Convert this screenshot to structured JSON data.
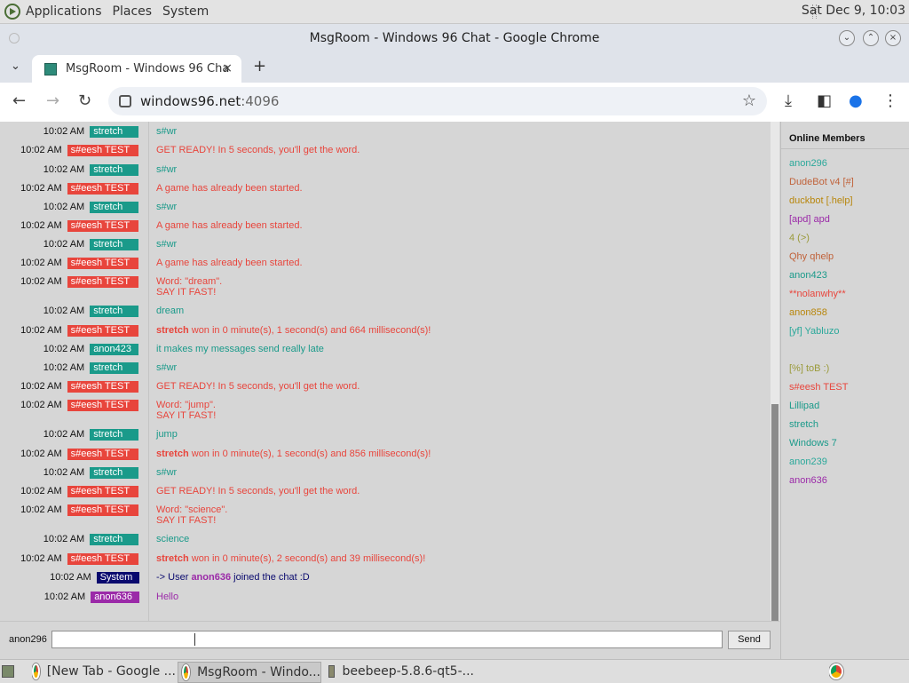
{
  "topbar": {
    "menus": [
      "Applications",
      "Places",
      "System"
    ],
    "clock": "Sat Dec 9, 10:03"
  },
  "window": {
    "title": "MsgRoom - Windows 96 Chat - Google Chrome"
  },
  "tab": {
    "title": "MsgRoom - Windows 96 Cha",
    "close_icon": "×",
    "new_tab_icon": "+"
  },
  "address": {
    "host": "windows96.net",
    "port": ":4096"
  },
  "chat": {
    "messages": [
      {
        "time": "10:02 AM",
        "user": "stretch",
        "badge_color": "#1a9a8a",
        "text": "s#wr",
        "text_color": "#1a9a8a"
      },
      {
        "time": "10:02 AM",
        "user": "s#eesh TEST",
        "badge_color": "#e8453c",
        "text": "GET READY! In 5 seconds, you'll get the word.",
        "text_color": "#e8453c"
      },
      {
        "time": "10:02 AM",
        "user": "stretch",
        "badge_color": "#1a9a8a",
        "text": "s#wr",
        "text_color": "#1a9a8a"
      },
      {
        "time": "10:02 AM",
        "user": "s#eesh TEST",
        "badge_color": "#e8453c",
        "text": "A game has already been started.",
        "text_color": "#e8453c"
      },
      {
        "time": "10:02 AM",
        "user": "stretch",
        "badge_color": "#1a9a8a",
        "text": "s#wr",
        "text_color": "#1a9a8a"
      },
      {
        "time": "10:02 AM",
        "user": "s#eesh TEST",
        "badge_color": "#e8453c",
        "text": "A game has already been started.",
        "text_color": "#e8453c"
      },
      {
        "time": "10:02 AM",
        "user": "stretch",
        "badge_color": "#1a9a8a",
        "text": "s#wr",
        "text_color": "#1a9a8a"
      },
      {
        "time": "10:02 AM",
        "user": "s#eesh TEST",
        "badge_color": "#e8453c",
        "text": "A game has already been started.",
        "text_color": "#e8453c"
      },
      {
        "time": "10:02 AM",
        "user": "s#eesh TEST",
        "badge_color": "#e8453c",
        "text": "Word: \"dream\".",
        "text2": "SAY IT FAST!",
        "text_color": "#e8453c"
      },
      {
        "time": "10:02 AM",
        "user": "stretch",
        "badge_color": "#1a9a8a",
        "text": "dream",
        "text_color": "#1a9a8a"
      },
      {
        "time": "10:02 AM",
        "user": "s#eesh TEST",
        "badge_color": "#e8453c",
        "bold": "stretch",
        "text": "won in 0 minute(s), 1 second(s) and 664 millisecond(s)!",
        "text_color": "#e8453c"
      },
      {
        "time": "10:02 AM",
        "user": "anon423",
        "badge_color": "#1a9a8a",
        "text": "it makes my messages send really late",
        "text_color": "#1a9a8a"
      },
      {
        "time": "10:02 AM",
        "user": "stretch",
        "badge_color": "#1a9a8a",
        "text": "s#wr",
        "text_color": "#1a9a8a"
      },
      {
        "time": "10:02 AM",
        "user": "s#eesh TEST",
        "badge_color": "#e8453c",
        "text": "GET READY! In 5 seconds, you'll get the word.",
        "text_color": "#e8453c"
      },
      {
        "time": "10:02 AM",
        "user": "s#eesh TEST",
        "badge_color": "#e8453c",
        "text": "Word: \"jump\".",
        "text2": "SAY IT FAST!",
        "text_color": "#e8453c"
      },
      {
        "time": "10:02 AM",
        "user": "stretch",
        "badge_color": "#1a9a8a",
        "text": "jump",
        "text_color": "#1a9a8a"
      },
      {
        "time": "10:02 AM",
        "user": "s#eesh TEST",
        "badge_color": "#e8453c",
        "bold": "stretch",
        "text": "won in 0 minute(s), 1 second(s) and 856 millisecond(s)!",
        "text_color": "#e8453c"
      },
      {
        "time": "10:02 AM",
        "user": "stretch",
        "badge_color": "#1a9a8a",
        "text": "s#wr",
        "text_color": "#1a9a8a"
      },
      {
        "time": "10:02 AM",
        "user": "s#eesh TEST",
        "badge_color": "#e8453c",
        "text": "GET READY! In 5 seconds, you'll get the word.",
        "text_color": "#e8453c"
      },
      {
        "time": "10:02 AM",
        "user": "s#eesh TEST",
        "badge_color": "#e8453c",
        "text": "Word: \"science\".",
        "text2": "SAY IT FAST!",
        "text_color": "#e8453c"
      },
      {
        "time": "10:02 AM",
        "user": "stretch",
        "badge_color": "#1a9a8a",
        "text": "science",
        "text_color": "#1a9a8a"
      },
      {
        "time": "10:02 AM",
        "user": "s#eesh TEST",
        "badge_color": "#e8453c",
        "bold": "stretch",
        "text": "won in 0 minute(s), 2 second(s) and 39 millisecond(s)!",
        "text_color": "#e8453c"
      },
      {
        "time": "10:02 AM",
        "user": "System",
        "badge_color": "#0a0a6e",
        "text": "-> User",
        "bold_mid": "anon636",
        "text_after": "joined the chat :D",
        "text_color": "#0a0a6e"
      },
      {
        "time": "10:02 AM",
        "user": "anon636",
        "badge_color": "#9b2aa8",
        "text": "Hello",
        "text_color": "#9b2aa8"
      }
    ]
  },
  "members": {
    "title": "Online Members",
    "list": [
      {
        "name": "anon296",
        "color": "#2aa89a"
      },
      {
        "name": "DudeBot v4 [#]",
        "color": "#c0623a"
      },
      {
        "name": "duckbot [.help]",
        "color": "#b8860b"
      },
      {
        "name": "[apd] apd",
        "color": "#9b2aa8"
      },
      {
        "name": "4 (>)",
        "color": "#9a9a3a"
      },
      {
        "name": "Qhy   qhelp",
        "color": "#c0623a"
      },
      {
        "name": "anon423",
        "color": "#1a9a8a"
      },
      {
        "name": "**nolanwhy**",
        "color": "#e8453c"
      },
      {
        "name": "anon858",
        "color": "#b8860b"
      },
      {
        "name": "[yf] Yabluzo",
        "color": "#2aa89a"
      },
      {
        "name": "[%] toB :)",
        "color": "#9a9a3a"
      },
      {
        "name": "s#eesh TEST",
        "color": "#e8453c"
      },
      {
        "name": "Lillipad",
        "color": "#1a9a8a"
      },
      {
        "name": "stretch",
        "color": "#1a9a8a"
      },
      {
        "name": "Windows 7",
        "color": "#1a9a8a"
      },
      {
        "name": "anon239",
        "color": "#2aa89a"
      },
      {
        "name": "anon636",
        "color": "#9b2aa8"
      }
    ]
  },
  "input": {
    "username": "anon296",
    "value": "",
    "send_label": "Send"
  },
  "taskbar": {
    "items": [
      {
        "label": "[New Tab - Google ...",
        "icon": "chrome-icon"
      },
      {
        "label": "MsgRoom - Windo...",
        "icon": "chrome-icon"
      },
      {
        "label": "beebeep-5.8.6-qt5-...",
        "icon": "folder-icon"
      }
    ]
  }
}
